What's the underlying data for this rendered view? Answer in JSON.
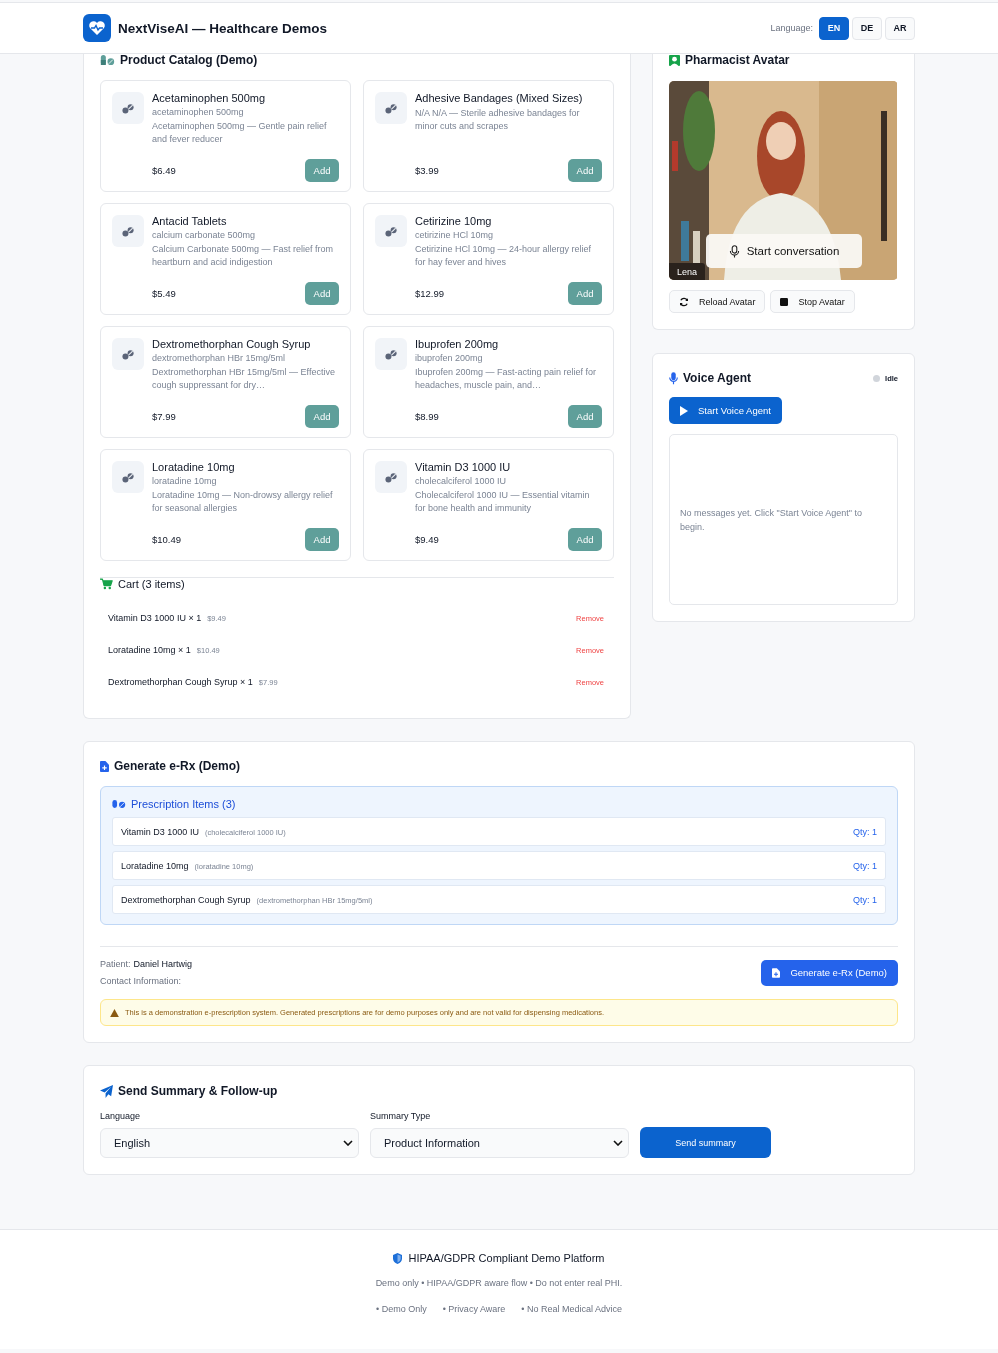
{
  "header": {
    "title": "NextViseAI — Healthcare Demos",
    "language_label": "Language:",
    "languages": [
      {
        "label": "EN",
        "selected": true
      },
      {
        "label": "DE",
        "selected": false
      },
      {
        "label": "AR",
        "selected": false
      }
    ]
  },
  "catalog": {
    "title": "Product Catalog (Demo)",
    "products": [
      {
        "name": "Acetaminophen 500mg",
        "generic": "acetaminophen 500mg",
        "description": "Acetaminophen 500mg — Gentle pain relief and fever reducer",
        "price": "$6.49",
        "button": "Add"
      },
      {
        "name": "Adhesive Bandages (Mixed Sizes)",
        "description": "N/A N/A — Sterile adhesive bandages for minor cuts and scrapes",
        "price": "$3.99",
        "button": "Add"
      },
      {
        "name": "Antacid Tablets",
        "generic": "calcium carbonate 500mg",
        "description": "Calcium Carbonate 500mg — Fast relief from heartburn and acid indigestion",
        "price": "$5.49",
        "button": "Add"
      },
      {
        "name": "Cetirizine 10mg",
        "generic": "cetirizine HCl 10mg",
        "description": "Cetirizine HCl 10mg — 24-hour allergy relief for hay fever and hives",
        "price": "$12.99",
        "button": "Add"
      },
      {
        "name": "Dextromethorphan Cough Syrup",
        "generic": "dextromethorphan HBr 15mg/5ml",
        "description": "Dextromethorphan HBr 15mg/5ml — Effective cough suppressant for dry…",
        "price": "$7.99",
        "button": "Add"
      },
      {
        "name": "Ibuprofen 200mg",
        "generic": "ibuprofen 200mg",
        "description": "Ibuprofen 200mg — Fast-acting pain relief for headaches, muscle pain, and…",
        "price": "$8.99",
        "button": "Add"
      },
      {
        "name": "Loratadine 10mg",
        "generic": "loratadine 10mg",
        "description": "Loratadine 10mg — Non-drowsy allergy relief for seasonal allergies",
        "price": "$10.49",
        "button": "Add"
      },
      {
        "name": "Vitamin D3 1000 IU",
        "generic": "cholecalciferol 1000 IU",
        "description": "Cholecalciferol 1000 IU — Essential vitamin for bone health and immunity",
        "price": "$9.49",
        "button": "Add"
      }
    ]
  },
  "cart": {
    "title": "Cart (3 items)",
    "items": [
      {
        "name": "Vitamin D3 1000 IU × 1",
        "price": "$9.49",
        "action": "Remove"
      },
      {
        "name": "Loratadine 10mg × 1",
        "price": "$10.49",
        "action": "Remove"
      },
      {
        "name": "Dextromethorphan Cough Syrup × 1",
        "price": "$7.99",
        "action": "Remove"
      }
    ]
  },
  "avatar": {
    "title": "Pharmacist Avatar",
    "name_tag": "Lena",
    "start_button": "Start conversation",
    "buttons": [
      {
        "label": "Reload Avatar",
        "kind": "reload"
      },
      {
        "label": "Stop Avatar",
        "kind": "stop"
      }
    ]
  },
  "voice": {
    "title": "Voice Agent",
    "status": "Idle",
    "start_button": "Start Voice Agent",
    "empty_message": "No messages yet. Click \"Start Voice Agent\" to begin."
  },
  "erx": {
    "title": "Generate e-Rx (Demo)",
    "items_title": "Prescription Items (3)",
    "items": [
      {
        "name": "Vitamin D3 1000 IU",
        "generic": "(cholecalciferol 1000 IU)",
        "qty": "Qty: 1"
      },
      {
        "name": "Loratadine 10mg",
        "generic": "(loratadine 10mg)",
        "qty": "Qty: 1"
      },
      {
        "name": "Dextromethorphan Cough Syrup",
        "generic": "(dextromethorphan HBr 15mg/5ml)",
        "qty": "Qty: 1"
      }
    ],
    "patient_label": "Patient:",
    "patient_name": "Daniel Hartwig",
    "contact_label": "Contact Information:",
    "generate_button": "Generate e-Rx (Demo)",
    "warning": "This is a demonstration e-prescription system. Generated prescriptions are for demo purposes only and are not valid for dispensing medications."
  },
  "summary": {
    "title": "Send Summary & Follow-up",
    "fields": [
      {
        "label": "Language",
        "value": "English"
      },
      {
        "label": "Summary Type",
        "value": "Product Information"
      }
    ],
    "button": "Send summary"
  },
  "footer": {
    "title": "HIPAA/GDPR Compliant Demo Platform",
    "note": "Demo only • HIPAA/GDPR aware flow • Do not enter real PHI.",
    "badges": [
      "• Demo Only",
      "• Privacy Aware",
      "• No Real Medical Advice"
    ]
  }
}
